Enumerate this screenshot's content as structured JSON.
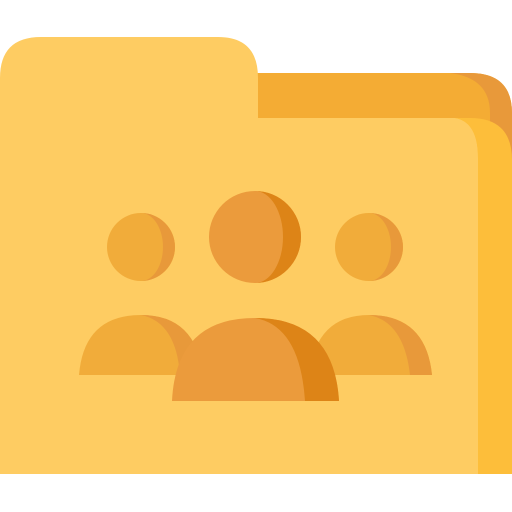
{
  "icon": {
    "name": "group-folder-icon",
    "colors": {
      "folder_body": "#FECC62",
      "folder_tab": "#FECC62",
      "folder_back": "#F4AC34",
      "folder_back_edge": "#E8993A",
      "folder_edge_right": "#FDBE3A",
      "person_side": "#F1AC3A",
      "person_center": "#EB9B3C",
      "person_shade": "#DD8417",
      "person_side_shade": "#E8993A"
    }
  }
}
